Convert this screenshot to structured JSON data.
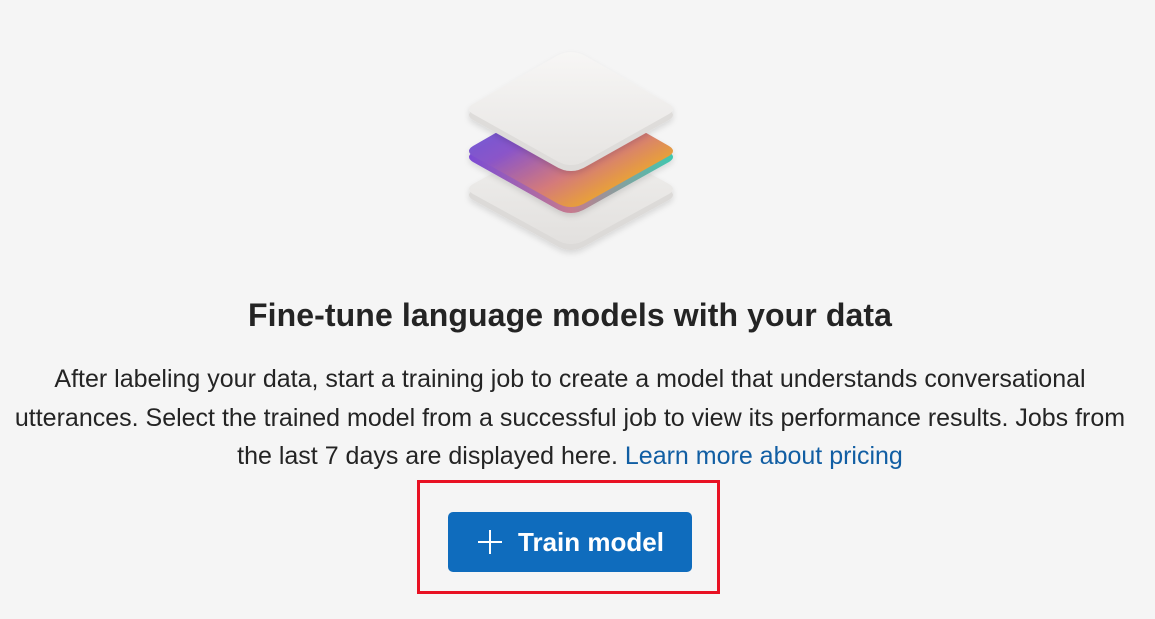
{
  "illustration": {
    "icon": "stacked-layers-icon",
    "colors": {
      "purple": "#6a4fd6",
      "teal": "#4fc4a8",
      "gold": "#f2b21a",
      "pink": "#d86a8a"
    }
  },
  "empty_state": {
    "title": "Fine-tune language models with your data",
    "description": "After labeling your data, start a training job to create a model that understands conversational utterances. Select the trained model from a successful job to view its performance results. Jobs from the last 7 days are displayed here.",
    "link_text": "Learn more about pricing"
  },
  "actions": {
    "train_button_label": "Train model",
    "train_button_icon": "plus-icon"
  },
  "colors": {
    "background": "#f5f5f5",
    "primary": "#0f6cbd",
    "link": "#115ea3",
    "highlight": "#e81123"
  }
}
